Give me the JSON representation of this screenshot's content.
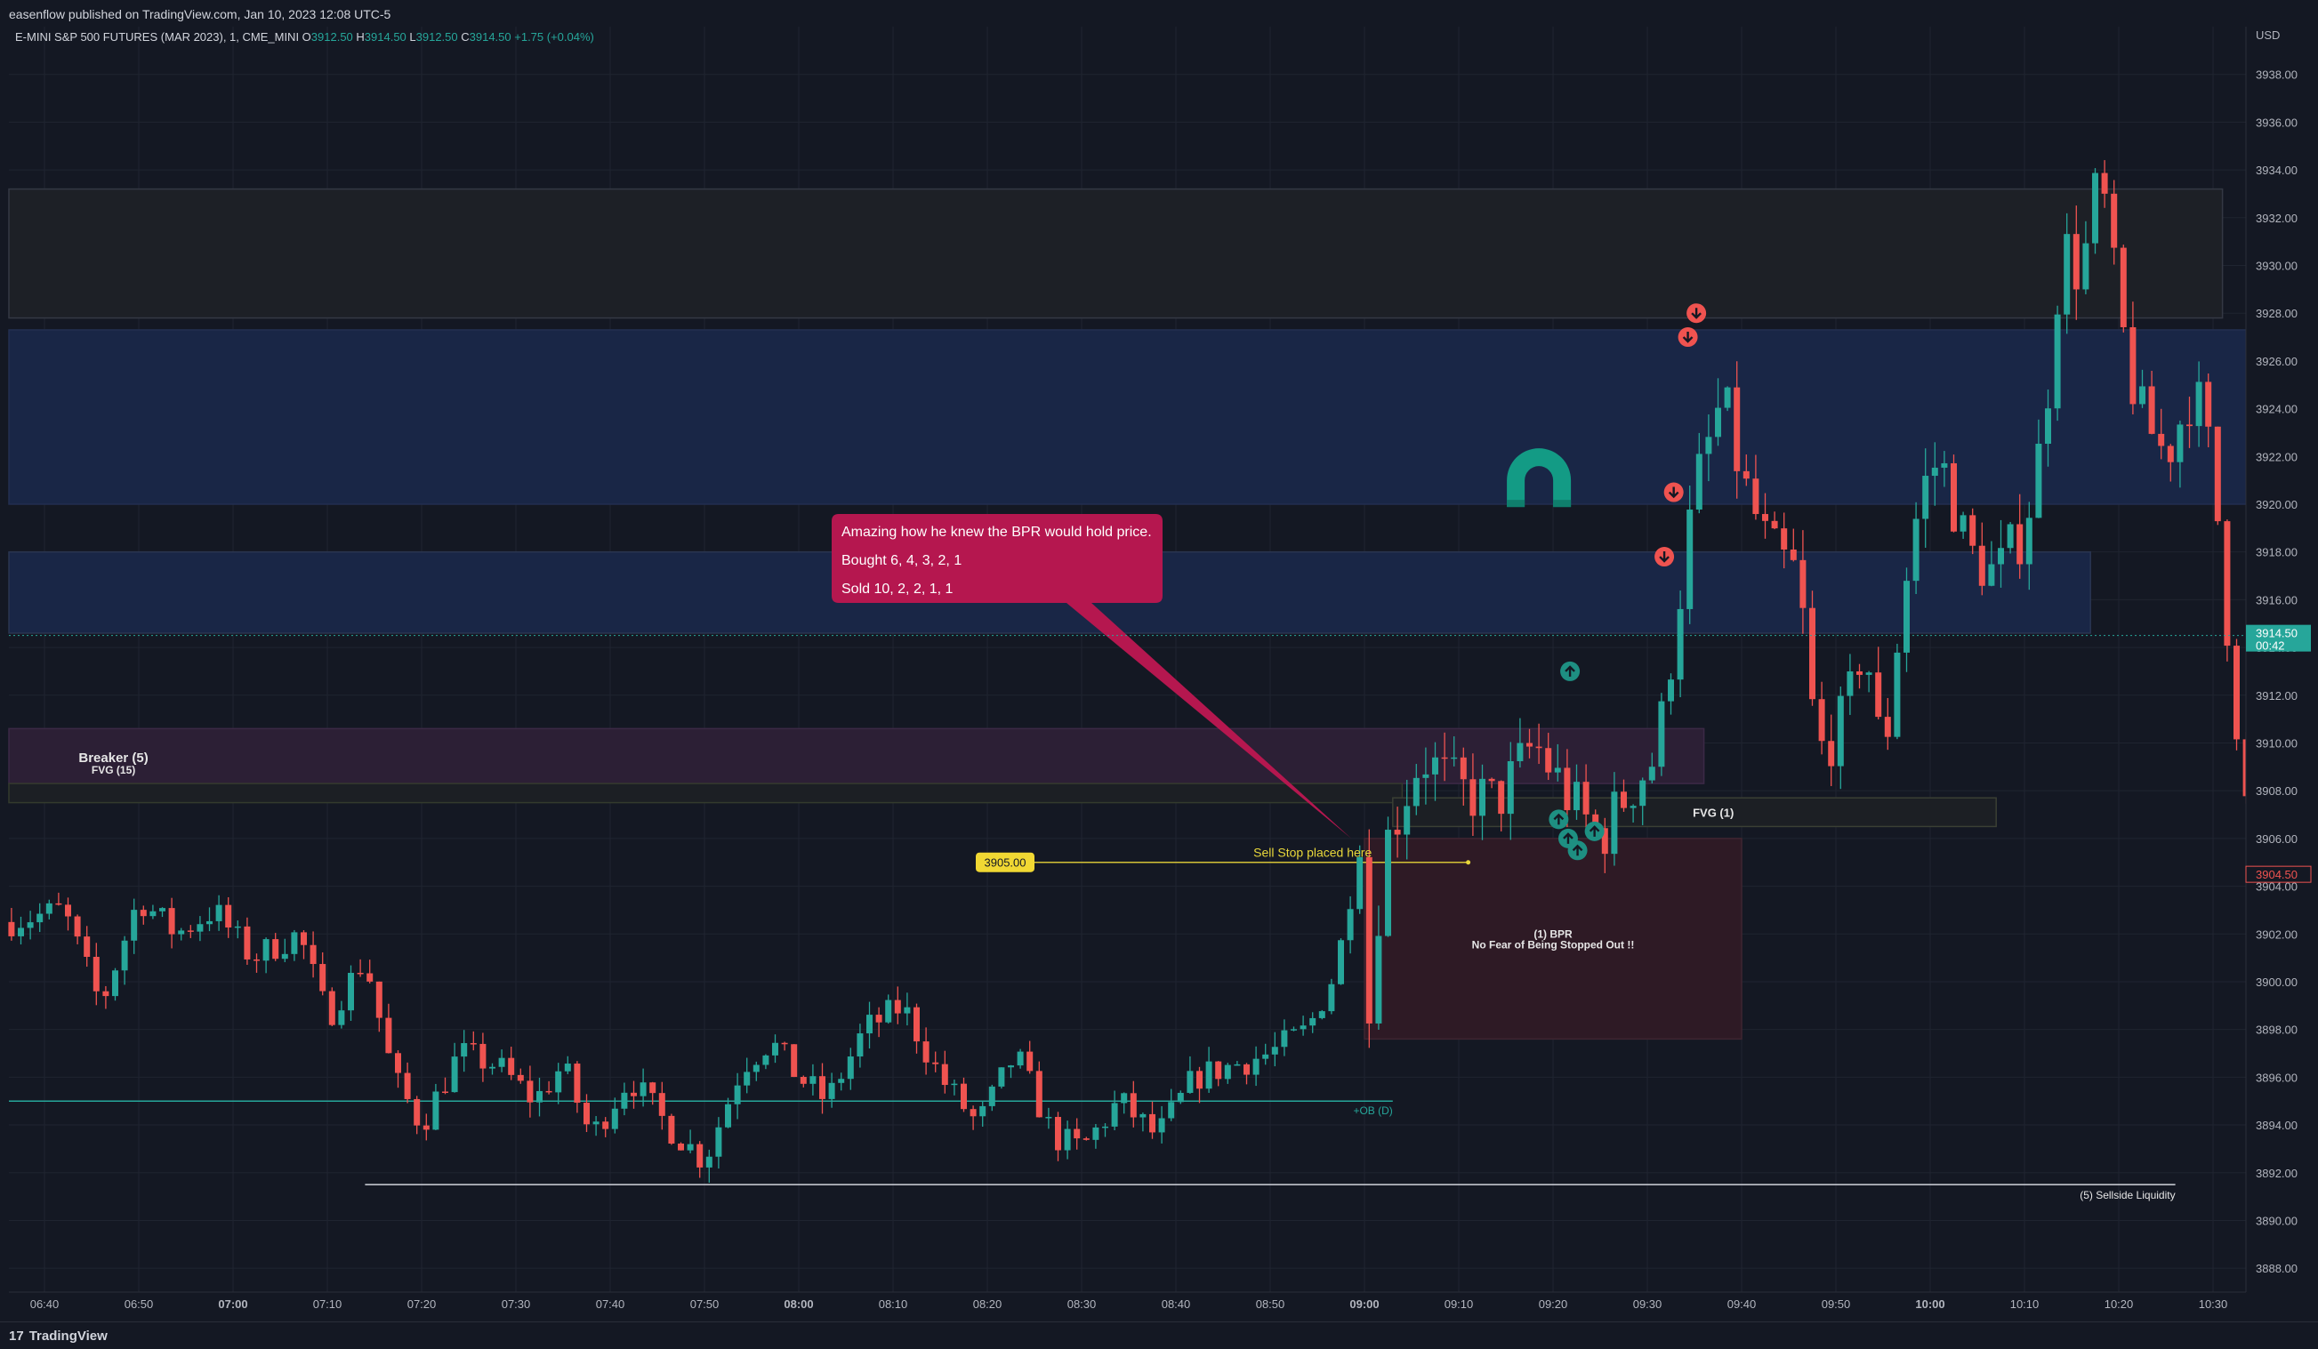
{
  "header": {
    "published": "easenflow published on TradingView.com, Jan 10, 2023 12:08 UTC-5",
    "symbol": "E-MINI S&P 500 FUTURES (MAR 2023), 1, CME_MINI",
    "o_label": "O",
    "o_value": "3912.50",
    "h_label": "H",
    "h_value": "3914.50",
    "l_label": "L",
    "l_value": "3912.50",
    "c_label": "C",
    "c_value": "3914.50",
    "change": "+1.75 (+0.04%)"
  },
  "footer": {
    "brand": "TradingView"
  },
  "colors": {
    "background": "#141823",
    "grid": "#1f2430",
    "up": "#26a69a",
    "down": "#ef5350",
    "axis_text": "#b2b5be",
    "callout": "#b5174f",
    "price_tag": "#26a69a"
  },
  "chart_data": {
    "type": "candlestick",
    "currency": "USD",
    "ylim": [
      3887,
      3940
    ],
    "y_ticks": [
      3888,
      3890,
      3892,
      3894,
      3896,
      3898,
      3900,
      3902,
      3904,
      3906,
      3908,
      3910,
      3912,
      3914,
      3916,
      3918,
      3920,
      3922,
      3924,
      3926,
      3928,
      3930,
      3932,
      3934,
      3936,
      3938
    ],
    "x_ticks": [
      {
        "label": "06:40",
        "min": 0,
        "bold": false
      },
      {
        "label": "06:50",
        "min": 10,
        "bold": false
      },
      {
        "label": "07:00",
        "min": 20,
        "bold": true
      },
      {
        "label": "07:10",
        "min": 30,
        "bold": false
      },
      {
        "label": "07:20",
        "min": 40,
        "bold": false
      },
      {
        "label": "07:30",
        "min": 50,
        "bold": false
      },
      {
        "label": "07:40",
        "min": 60,
        "bold": false
      },
      {
        "label": "07:50",
        "min": 70,
        "bold": false
      },
      {
        "label": "08:00",
        "min": 80,
        "bold": true
      },
      {
        "label": "08:10",
        "min": 90,
        "bold": false
      },
      {
        "label": "08:20",
        "min": 100,
        "bold": false
      },
      {
        "label": "08:30",
        "min": 110,
        "bold": false
      },
      {
        "label": "08:40",
        "min": 120,
        "bold": false
      },
      {
        "label": "08:50",
        "min": 130,
        "bold": false
      },
      {
        "label": "09:00",
        "min": 140,
        "bold": true
      },
      {
        "label": "09:10",
        "min": 150,
        "bold": false
      },
      {
        "label": "09:20",
        "min": 160,
        "bold": false
      },
      {
        "label": "09:30",
        "min": 170,
        "bold": false
      },
      {
        "label": "09:40",
        "min": 180,
        "bold": false
      },
      {
        "label": "09:50",
        "min": 190,
        "bold": false
      },
      {
        "label": "10:00",
        "min": 200,
        "bold": true
      },
      {
        "label": "10:10",
        "min": 210,
        "bold": false
      },
      {
        "label": "10:20",
        "min": 220,
        "bold": false
      },
      {
        "label": "10:30",
        "min": 230,
        "bold": false
      }
    ],
    "x_start": "06:36",
    "anchors": [
      [
        -4,
        3902.5
      ],
      [
        2,
        3903
      ],
      [
        6,
        3899
      ],
      [
        10,
        3903.5
      ],
      [
        14,
        3902
      ],
      [
        18,
        3903
      ],
      [
        22,
        3901
      ],
      [
        27,
        3902
      ],
      [
        30,
        3898.5
      ],
      [
        34,
        3901
      ],
      [
        37,
        3896
      ],
      [
        40,
        3894
      ],
      [
        44,
        3897
      ],
      [
        48,
        3896.5
      ],
      [
        52,
        3895
      ],
      [
        55,
        3896.5
      ],
      [
        58,
        3893.5
      ],
      [
        62,
        3896
      ],
      [
        66,
        3894
      ],
      [
        70,
        3892.5
      ],
      [
        74,
        3896.5
      ],
      [
        77,
        3897.5
      ],
      [
        80,
        3896
      ],
      [
        83,
        3895
      ],
      [
        87,
        3898
      ],
      [
        91,
        3899
      ],
      [
        95,
        3896
      ],
      [
        99,
        3894
      ],
      [
        103,
        3897
      ],
      [
        107,
        3893.5
      ],
      [
        110,
        3893
      ],
      [
        114,
        3895
      ],
      [
        118,
        3893.5
      ],
      [
        122,
        3896
      ],
      [
        126,
        3896.5
      ],
      [
        130,
        3897
      ],
      [
        134,
        3898
      ],
      [
        137,
        3900.5
      ],
      [
        139.5,
        3905.8
      ],
      [
        140.5,
        3898.5
      ],
      [
        142,
        3905.5
      ],
      [
        146,
        3909.5
      ],
      [
        150,
        3908
      ],
      [
        154,
        3907.5
      ],
      [
        158,
        3910
      ],
      [
        162,
        3907.5
      ],
      [
        165,
        3906
      ],
      [
        168,
        3908
      ],
      [
        171,
        3909.5
      ],
      [
        173,
        3915
      ],
      [
        175,
        3920.5
      ],
      [
        178,
        3924.5
      ],
      [
        180,
        3921
      ],
      [
        183,
        3918
      ],
      [
        186,
        3917
      ],
      [
        188,
        3909.5
      ],
      [
        191,
        3911
      ],
      [
        193,
        3914.5
      ],
      [
        195,
        3909
      ],
      [
        197,
        3916
      ],
      [
        199,
        3920.5
      ],
      [
        201,
        3922
      ],
      [
        204,
        3918
      ],
      [
        207,
        3917
      ],
      [
        210,
        3919
      ],
      [
        212,
        3923
      ],
      [
        214,
        3931
      ],
      [
        216,
        3929.5
      ],
      [
        218,
        3934
      ],
      [
        220,
        3928
      ],
      [
        222,
        3924
      ],
      [
        225,
        3922
      ],
      [
        228,
        3925
      ],
      [
        230,
        3921.5
      ],
      [
        232,
        3913
      ],
      [
        234,
        3905.5
      ],
      [
        235.5,
        3909.5
      ],
      [
        236,
        3904.5
      ]
    ],
    "last_price": "3914.50",
    "last_price_timer": "00:42",
    "low_price_tag": "3904.50",
    "zones": [
      {
        "name": "gray-top-zone",
        "x0": -4,
        "x1": 231,
        "y0": 3927.8,
        "y1": 3933.2,
        "fill": "#1d2026",
        "stroke": "#343844"
      },
      {
        "name": "blue-upper-zone",
        "x0": -4,
        "x1": 237,
        "y0": 3920,
        "y1": 3927.3,
        "fill": "#192646",
        "stroke": "#232f50"
      },
      {
        "name": "blue-lower-zone",
        "x0": -4,
        "x1": 217,
        "y0": 3914.6,
        "y1": 3918,
        "fill": "#192646",
        "stroke": "#2a3550"
      },
      {
        "name": "breaker-zone",
        "x0": -4,
        "x1": 176,
        "y0": 3908.3,
        "y1": 3910.6,
        "fill": "#2c1f35",
        "stroke": "#3b2946"
      },
      {
        "name": "fvg15-zone",
        "x0": -4,
        "x1": 144,
        "y0": 3907.5,
        "y1": 3908.3,
        "fill": "#1c1f24",
        "stroke": "#333a2d"
      },
      {
        "name": "fvg1-zone",
        "x0": 143,
        "x1": 207,
        "y0": 3906.5,
        "y1": 3907.7,
        "fill": "#1c1f24",
        "stroke": "#3a3f34"
      },
      {
        "name": "bpr-zone",
        "x0": 140,
        "x1": 180,
        "y0": 3897.6,
        "y1": 3906,
        "fill": "#2e1a25",
        "stroke": "#3e2531"
      }
    ],
    "lines": [
      {
        "name": "ob-daily-line",
        "x0": -4,
        "x1": 143,
        "price": 3895,
        "color": "#26a69a"
      },
      {
        "name": "sellside-liquidity-line",
        "x0": 34,
        "x1": 226,
        "price": 3891.5,
        "color": "#d1d4dc"
      },
      {
        "name": "sell-stop-line",
        "x0": 105,
        "x1": 151,
        "price": 3905,
        "color": "#d4c236"
      }
    ],
    "labels": {
      "breaker": "Breaker (5)",
      "fvg15": "FVG (15)",
      "fvg1": "FVG (1)",
      "bpr_title": "(1) BPR",
      "bpr_sub": "No Fear of Being Stopped Out !!",
      "ob": "+OB (D)",
      "sellside": "(5) Sellside Liquidity",
      "sell_stop": "Sell Stop placed here",
      "sell_stop_price": "3905.00"
    },
    "callout": {
      "lines": [
        "Amazing how he knew the BPR would hold price.",
        "Bought 6, 4, 3, 2, 1",
        "Sold 10, 2, 2, 1, 1"
      ]
    },
    "sell_markers": [
      [
        175.2,
        3928
      ],
      [
        174.3,
        3927
      ],
      [
        172.8,
        3920.5
      ],
      [
        171.8,
        3917.8
      ]
    ],
    "buy_markers": [
      [
        161.8,
        3913
      ],
      [
        160.6,
        3906.8
      ],
      [
        161.6,
        3906
      ],
      [
        162.6,
        3905.5
      ],
      [
        164.4,
        3906.3
      ]
    ]
  }
}
